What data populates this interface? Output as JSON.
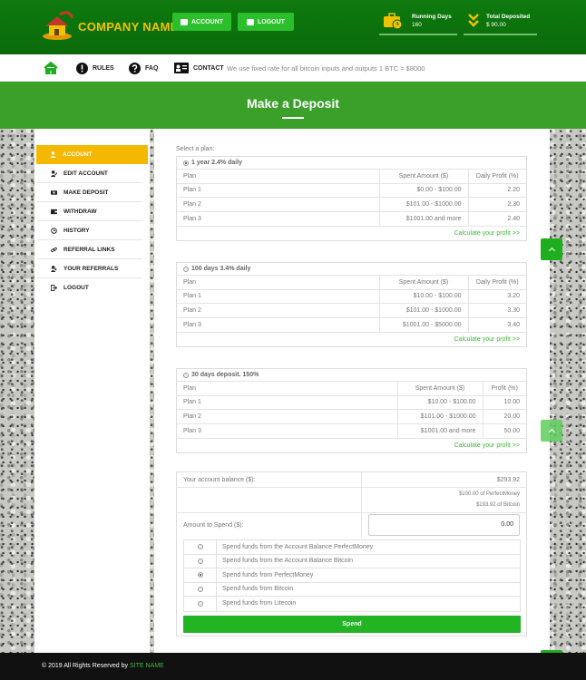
{
  "header": {
    "company_name": "COMPANY NAME",
    "account_button": "ACCOUNT",
    "logout_button": "LOGOUT",
    "stats": [
      {
        "label": "Running Days",
        "value": "160",
        "icon": "briefcase-clock-icon"
      },
      {
        "label": "Total Deposited",
        "value": "$ 90.00",
        "icon": "double-chevron-down-icon"
      }
    ],
    "colors": {
      "primary": "#0e7a0e",
      "accent": "#f2c200",
      "button": "#2bc02b"
    }
  },
  "nav": {
    "items": [
      {
        "label": "",
        "icon": "home-icon"
      },
      {
        "label": "RULES",
        "icon": "exclamation-icon"
      },
      {
        "label": "FAQ",
        "icon": "question-icon"
      },
      {
        "label": "CONTACT",
        "icon": "contact-card-icon"
      }
    ],
    "note": "We use fixed rate for all bitcoin inputs and outputs 1 BTC = $8000"
  },
  "banner": {
    "title": "Make a Deposit"
  },
  "sidebar": {
    "items": [
      {
        "label": "ACCOUNT",
        "icon": "user-icon",
        "active": true
      },
      {
        "label": "EDIT ACCOUNT",
        "icon": "user-edit-icon"
      },
      {
        "label": "MAKE DEPOSIT",
        "icon": "money-icon"
      },
      {
        "label": "WITHDRAW",
        "icon": "wallet-icon"
      },
      {
        "label": "HISTORY",
        "icon": "history-icon"
      },
      {
        "label": "REFERRAL LINKS",
        "icon": "link-icon"
      },
      {
        "label": "YOUR REFERRALS",
        "icon": "users-icon"
      },
      {
        "label": "LOGOUT",
        "icon": "logout-icon"
      }
    ]
  },
  "deposit": {
    "select_label": "Select a plan:",
    "calc_link": "Calculate your profit >>",
    "plans": [
      {
        "name": "1 year 2.4% daily",
        "selected": true,
        "headers": [
          "Plan",
          "Spent Amount ($)",
          "Daily Profit (%)"
        ],
        "rows": [
          [
            "Plan 1",
            "$0.00 - $100.00",
            "2.20"
          ],
          [
            "Plan 2",
            "$101.00 - $1000.00",
            "2.30"
          ],
          [
            "Plan 3",
            "$1001.00 and more",
            "2.40"
          ]
        ]
      },
      {
        "name": "100 days 3.4% daily",
        "selected": false,
        "headers": [
          "Plan",
          "Spent Amount ($)",
          "Daily Profit (%)"
        ],
        "rows": [
          [
            "Plan 1",
            "$10.00 - $100.00",
            "3.20"
          ],
          [
            "Plan 2",
            "$101.00 - $1000.00",
            "3.30"
          ],
          [
            "Plan 3",
            "$1001.00 - $5000.00",
            "3.40"
          ]
        ]
      },
      {
        "name": "30 days deposit. 150%",
        "selected": false,
        "headers": [
          "Plan",
          "Spent Amount ($)",
          "Profit (%)"
        ],
        "rows": [
          [
            "Plan 1",
            "$10.00 - $100.00",
            "10.00"
          ],
          [
            "Plan 2",
            "$101.00 - $1000.00",
            "20.00"
          ],
          [
            "Plan 3",
            "$1001.00 and more",
            "50.00"
          ]
        ]
      }
    ],
    "balance_label": "Your account balance ($):",
    "balance_value": "$293.92",
    "balance_pm": "$100.00 of PerfectMoney",
    "balance_btc": "$193.92 of Bitcoin",
    "amount_label": "Amount to Spend ($):",
    "amount_value": "0.00",
    "spend_options": [
      {
        "label": "Spend funds from the Account Balance PerfectMoney",
        "selected": false
      },
      {
        "label": "Spend funds from the Account Balance Bitcoin",
        "selected": false
      },
      {
        "label": "Spend funds from PerfectMoney",
        "selected": true
      },
      {
        "label": "Spend funds from Bitcoin",
        "selected": false
      },
      {
        "label": "Spend funds from Litecoin",
        "selected": false
      }
    ],
    "spend_button": "Spend"
  },
  "footer": {
    "copyright": "© 2019 All Rights Reserved by",
    "site_name": "SITE NAME"
  }
}
